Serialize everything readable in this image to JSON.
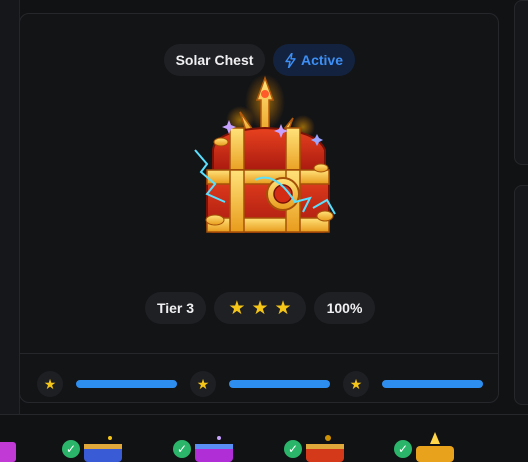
{
  "chest": {
    "name": "Solar Chest",
    "status": "Active",
    "status_icon": "bolt-icon",
    "tier": "Tier 3",
    "stars": 3,
    "star_glyph": "★",
    "progress": "100%"
  },
  "milestones": [
    {
      "icon": "star-icon",
      "glyph": "★",
      "progress": 1.0
    },
    {
      "icon": "star-icon",
      "glyph": "★",
      "progress": 1.0
    },
    {
      "icon": "star-icon",
      "glyph": "★",
      "progress": 1.0
    }
  ],
  "collection_row": {
    "items": [
      {
        "icon": "chest-thumbnail",
        "claimed": true,
        "check_glyph": "✓"
      },
      {
        "icon": "chest-thumbnail",
        "claimed": true,
        "check_glyph": "✓"
      },
      {
        "icon": "chest-thumbnail",
        "claimed": true,
        "check_glyph": "✓"
      },
      {
        "icon": "chest-thumbnail",
        "claimed": true,
        "check_glyph": "✓"
      }
    ]
  },
  "colors": {
    "accent_blue": "#2e8ef0",
    "status_text": "#3d8ff5",
    "star_gold": "#f5c518",
    "check_green": "#2bb56a"
  }
}
